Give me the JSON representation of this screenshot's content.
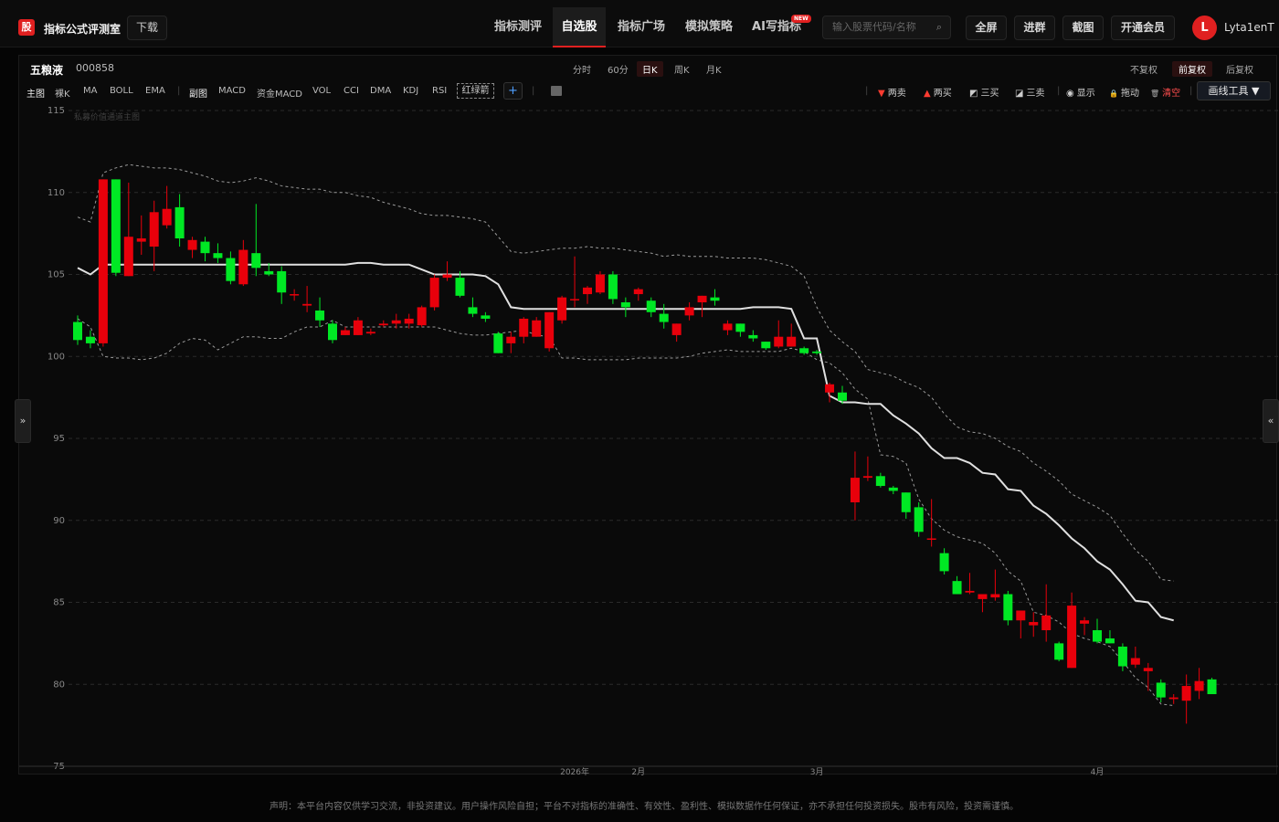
{
  "topbar": {
    "logo_text": "股",
    "app_title": "指标公式评测室",
    "download": "下载",
    "nav": [
      {
        "label": "指标测评",
        "active": false
      },
      {
        "label": "自选股",
        "active": true
      },
      {
        "label": "指标广场",
        "active": false
      },
      {
        "label": "模拟策略",
        "active": false
      },
      {
        "label": "AI写指标",
        "active": false
      }
    ],
    "new_badge": "NEW",
    "search_placeholder": "输入股票代码/名称",
    "buttons": [
      "全屏",
      "进群",
      "截图",
      "开通会员"
    ],
    "avatar_letter": "L",
    "username": "Lyta1enT"
  },
  "stock": {
    "name": "五粮液",
    "code": "000858",
    "periods": [
      {
        "label": "分时",
        "active": false
      },
      {
        "label": "60分",
        "active": false
      },
      {
        "label": "日K",
        "active": true
      },
      {
        "label": "周K",
        "active": false
      },
      {
        "label": "月K",
        "active": false
      }
    ],
    "adjust": [
      {
        "label": "不复权",
        "active": false
      },
      {
        "label": "前复权",
        "active": true
      },
      {
        "label": "后复权",
        "active": false
      }
    ]
  },
  "indicators": {
    "main_label": "主图",
    "main": [
      "裸K",
      "MA",
      "BOLL",
      "EMA"
    ],
    "sub_label": "副图",
    "sub": [
      "MACD",
      "资金MACD",
      "VOL",
      "CCI",
      "DMA",
      "KDJ",
      "RSI"
    ],
    "highlight": "红绿箭",
    "add": "+"
  },
  "tools": [
    {
      "label": "两卖",
      "glyph": "▼",
      "color": "#ff3b30"
    },
    {
      "label": "两买",
      "glyph": "▲",
      "color": "#ff3b30"
    },
    {
      "label": "三买",
      "glyph": "◩",
      "color": "#e8e8e8"
    },
    {
      "label": "三卖",
      "glyph": "◪",
      "color": "#e8e8e8"
    },
    {
      "label": "显示",
      "glyph": "◉",
      "color": "#e8e8e8"
    },
    {
      "label": "拖动",
      "glyph": "🔒",
      "color": "#f0b000"
    },
    {
      "label": "清空",
      "glyph": "🗑",
      "color": "#ff4d4d"
    }
  ],
  "draw_tools": "画线工具 ▼",
  "chart": {
    "watermark": "私募价值通道主图",
    "x_labels": [
      {
        "text": "2026年",
        "i": 39
      },
      {
        "text": "2月",
        "i": 44
      },
      {
        "text": "3月",
        "i": 58
      },
      {
        "text": "4月",
        "i": 80
      }
    ],
    "colors": {
      "up": "#e8000b",
      "down": "#00e824",
      "mid": "#e0e0e0",
      "band": "#9a9a9a",
      "grid": "#2a2a2a"
    }
  },
  "chart_data": {
    "type": "candlestick",
    "title": "",
    "ylim": [
      75,
      115
    ],
    "yticks": [
      75,
      80,
      85,
      90,
      95,
      100,
      105,
      110,
      115
    ],
    "ohlc": [
      [
        102.1,
        102.5,
        100.7,
        101.0
      ],
      [
        101.2,
        101.6,
        100.5,
        100.8
      ],
      [
        100.8,
        110.8,
        100.6,
        110.8
      ],
      [
        110.8,
        110.8,
        104.9,
        105.1
      ],
      [
        104.9,
        110.6,
        104.9,
        107.3
      ],
      [
        107.0,
        108.6,
        106.2,
        107.2
      ],
      [
        106.7,
        109.5,
        105.2,
        108.8
      ],
      [
        108.0,
        110.4,
        107.8,
        109.0
      ],
      [
        109.1,
        109.9,
        106.7,
        107.2
      ],
      [
        106.5,
        107.3,
        106.0,
        107.1
      ],
      [
        107.0,
        107.3,
        105.8,
        106.3
      ],
      [
        106.3,
        106.9,
        105.7,
        106.0
      ],
      [
        106.0,
        106.4,
        104.4,
        104.6
      ],
      [
        104.4,
        107.1,
        104.3,
        106.5
      ],
      [
        106.3,
        109.3,
        104.9,
        105.4
      ],
      [
        105.2,
        105.7,
        104.9,
        105.0
      ],
      [
        105.2,
        105.5,
        103.2,
        103.9
      ],
      [
        103.8,
        104.1,
        103.4,
        103.8
      ],
      [
        103.1,
        104.3,
        102.7,
        103.2
      ],
      [
        102.8,
        103.6,
        101.8,
        102.2
      ],
      [
        102.0,
        102.2,
        100.8,
        101.0
      ],
      [
        101.3,
        101.8,
        101.3,
        101.6
      ],
      [
        101.3,
        102.4,
        101.3,
        102.2
      ],
      [
        101.4,
        101.7,
        101.3,
        101.5
      ],
      [
        101.9,
        102.2,
        101.8,
        102.0
      ],
      [
        102.0,
        102.6,
        101.7,
        102.2
      ],
      [
        102.0,
        102.6,
        101.7,
        102.3
      ],
      [
        101.9,
        103.1,
        101.8,
        103.0
      ],
      [
        103.0,
        105.0,
        102.8,
        104.8
      ],
      [
        104.8,
        105.8,
        104.6,
        105.0
      ],
      [
        104.8,
        105.2,
        103.6,
        103.7
      ],
      [
        103.0,
        103.6,
        102.4,
        102.6
      ],
      [
        102.5,
        102.7,
        102.1,
        102.3
      ],
      [
        101.4,
        101.5,
        100.2,
        100.2
      ],
      [
        100.8,
        101.5,
        100.2,
        101.2
      ],
      [
        101.2,
        102.4,
        100.8,
        102.3
      ],
      [
        101.2,
        102.4,
        101.2,
        102.2
      ],
      [
        100.5,
        102.7,
        100.3,
        102.7
      ],
      [
        102.2,
        103.7,
        102.0,
        103.6
      ],
      [
        103.5,
        106.1,
        103.0,
        103.5
      ],
      [
        103.8,
        104.3,
        103.2,
        104.2
      ],
      [
        103.9,
        105.2,
        103.8,
        105.0
      ],
      [
        105.0,
        105.2,
        103.2,
        103.5
      ],
      [
        103.3,
        103.6,
        102.4,
        103.0
      ],
      [
        103.8,
        104.2,
        103.4,
        104.1
      ],
      [
        103.4,
        103.6,
        102.4,
        102.7
      ],
      [
        102.6,
        103.2,
        101.7,
        102.1
      ],
      [
        101.3,
        102.0,
        100.9,
        102.0
      ],
      [
        102.5,
        103.3,
        102.2,
        103.0
      ],
      [
        103.3,
        103.7,
        102.4,
        103.7
      ],
      [
        103.6,
        104.1,
        103.1,
        103.4
      ],
      [
        101.6,
        102.2,
        101.3,
        102.0
      ],
      [
        102.0,
        102.0,
        101.2,
        101.5
      ],
      [
        101.3,
        101.6,
        100.9,
        101.1
      ],
      [
        100.9,
        100.9,
        100.4,
        100.5
      ],
      [
        100.6,
        102.2,
        100.5,
        101.2
      ],
      [
        100.6,
        102.0,
        100.6,
        101.2
      ],
      [
        100.5,
        100.6,
        100.1,
        100.2
      ],
      [
        100.3,
        100.4,
        100.1,
        100.2
      ],
      [
        97.8,
        98.4,
        97.2,
        98.3
      ],
      [
        97.8,
        98.2,
        97.1,
        97.3
      ],
      [
        91.1,
        94.2,
        90.0,
        92.6
      ],
      [
        92.6,
        93.9,
        92.4,
        92.7
      ],
      [
        92.7,
        92.9,
        92.0,
        92.1
      ],
      [
        92.0,
        92.1,
        91.6,
        91.8
      ],
      [
        91.7,
        91.7,
        90.1,
        90.5
      ],
      [
        90.8,
        91.1,
        89.0,
        89.3
      ],
      [
        88.9,
        91.3,
        88.4,
        88.9
      ],
      [
        88.0,
        88.3,
        86.7,
        86.9
      ],
      [
        86.3,
        86.6,
        85.5,
        85.5
      ],
      [
        85.6,
        86.8,
        85.5,
        85.7
      ],
      [
        85.2,
        85.4,
        84.4,
        85.5
      ],
      [
        85.3,
        87.0,
        85.1,
        85.5
      ],
      [
        85.5,
        85.7,
        83.6,
        83.9
      ],
      [
        83.9,
        84.3,
        82.8,
        84.5
      ],
      [
        83.6,
        84.4,
        82.9,
        83.8
      ],
      [
        83.3,
        86.1,
        82.6,
        84.2
      ],
      [
        82.5,
        82.6,
        81.4,
        81.5
      ],
      [
        81.0,
        85.6,
        81.0,
        84.8
      ],
      [
        83.7,
        84.1,
        83.0,
        83.9
      ],
      [
        83.3,
        84.0,
        82.5,
        82.6
      ],
      [
        82.8,
        83.3,
        82.5,
        82.5
      ],
      [
        82.3,
        82.5,
        80.8,
        81.1
      ],
      [
        81.2,
        82.3,
        81.0,
        81.6
      ],
      [
        80.8,
        81.3,
        79.6,
        81.0
      ],
      [
        80.1,
        80.3,
        78.9,
        79.2
      ],
      [
        79.1,
        79.4,
        78.8,
        79.2
      ],
      [
        79.0,
        80.6,
        77.6,
        79.9
      ],
      [
        79.6,
        81.0,
        79.1,
        80.2
      ],
      [
        80.3,
        80.4,
        79.5,
        79.4
      ]
    ],
    "upper": [
      108.5,
      108.2,
      111.2,
      111.5,
      111.7,
      111.6,
      111.5,
      111.5,
      111.4,
      111.2,
      111.0,
      110.7,
      110.6,
      110.7,
      110.9,
      110.7,
      110.4,
      110.3,
      110.2,
      110.2,
      110.0,
      110.0,
      109.8,
      109.7,
      109.4,
      109.2,
      109.0,
      108.7,
      108.6,
      108.6,
      108.5,
      108.4,
      108.2,
      107.3,
      106.4,
      106.3,
      106.4,
      106.5,
      106.6,
      106.6,
      106.7,
      106.6,
      106.6,
      106.5,
      106.4,
      106.3,
      106.1,
      106.2,
      106.1,
      106.1,
      106.1,
      106.0,
      106.0,
      106.0,
      105.9,
      105.7,
      105.5,
      104.9,
      103.0,
      101.6,
      100.9,
      100.3,
      99.2,
      99.0,
      98.8,
      98.4,
      98.1,
      97.5,
      96.5,
      95.7,
      95.4,
      95.3,
      95.0,
      94.5,
      94.2,
      93.5,
      93.0,
      92.4,
      91.6,
      91.2,
      90.8,
      90.3,
      89.2,
      88.2,
      87.5,
      86.4,
      86.3
    ],
    "middle": [
      105.4,
      105.0,
      105.6,
      105.6,
      105.6,
      105.6,
      105.6,
      105.6,
      105.6,
      105.6,
      105.6,
      105.6,
      105.6,
      105.6,
      105.6,
      105.6,
      105.6,
      105.6,
      105.6,
      105.6,
      105.6,
      105.6,
      105.7,
      105.7,
      105.6,
      105.6,
      105.6,
      105.3,
      105.0,
      105.0,
      105.0,
      105.0,
      104.9,
      104.4,
      103.0,
      102.9,
      102.9,
      102.9,
      102.9,
      102.9,
      102.9,
      102.9,
      102.9,
      102.9,
      102.9,
      102.9,
      102.9,
      102.9,
      102.9,
      102.9,
      102.9,
      102.9,
      102.9,
      103.0,
      103.0,
      103.0,
      102.9,
      101.1,
      101.1,
      97.6,
      97.2,
      97.2,
      97.1,
      97.1,
      96.4,
      95.9,
      95.3,
      94.4,
      93.8,
      93.8,
      93.5,
      92.9,
      92.8,
      91.9,
      91.8,
      90.9,
      90.4,
      89.7,
      88.9,
      88.3,
      87.5,
      87.0,
      86.1,
      85.1,
      85.0,
      84.1,
      83.9
    ],
    "lower": [
      102.3,
      101.8,
      100.0,
      99.9,
      99.9,
      99.8,
      99.9,
      100.2,
      100.8,
      101.1,
      101.0,
      100.4,
      100.8,
      101.2,
      101.2,
      101.1,
      101.1,
      101.5,
      101.8,
      101.8,
      102.2,
      101.8,
      101.8,
      101.8,
      101.8,
      101.8,
      101.8,
      101.8,
      101.8,
      101.6,
      101.4,
      101.3,
      101.3,
      101.4,
      101.5,
      101.6,
      101.3,
      101.2,
      99.9,
      99.9,
      99.8,
      99.8,
      99.8,
      99.8,
      99.9,
      99.9,
      99.9,
      99.9,
      100.0,
      100.2,
      100.3,
      100.4,
      100.3,
      100.3,
      100.3,
      100.3,
      100.5,
      100.3,
      99.8,
      99.6,
      99.0,
      98.0,
      97.4,
      94.0,
      93.9,
      93.5,
      91.3,
      90.1,
      89.4,
      89.0,
      88.8,
      88.6,
      88.0,
      86.9,
      86.3,
      84.4,
      84.2,
      83.8,
      83.1,
      82.8,
      82.6,
      82.3,
      81.4,
      80.4,
      79.8,
      78.8,
      78.7
    ]
  },
  "disclaimer": "声明：本平台内容仅供学习交流，非投资建议。用户操作风险自担；平台不对指标的准确性、有效性、盈利性、模拟数据作任何保证，亦不承担任何投资损失。股市有风险，投资需谨慎。"
}
